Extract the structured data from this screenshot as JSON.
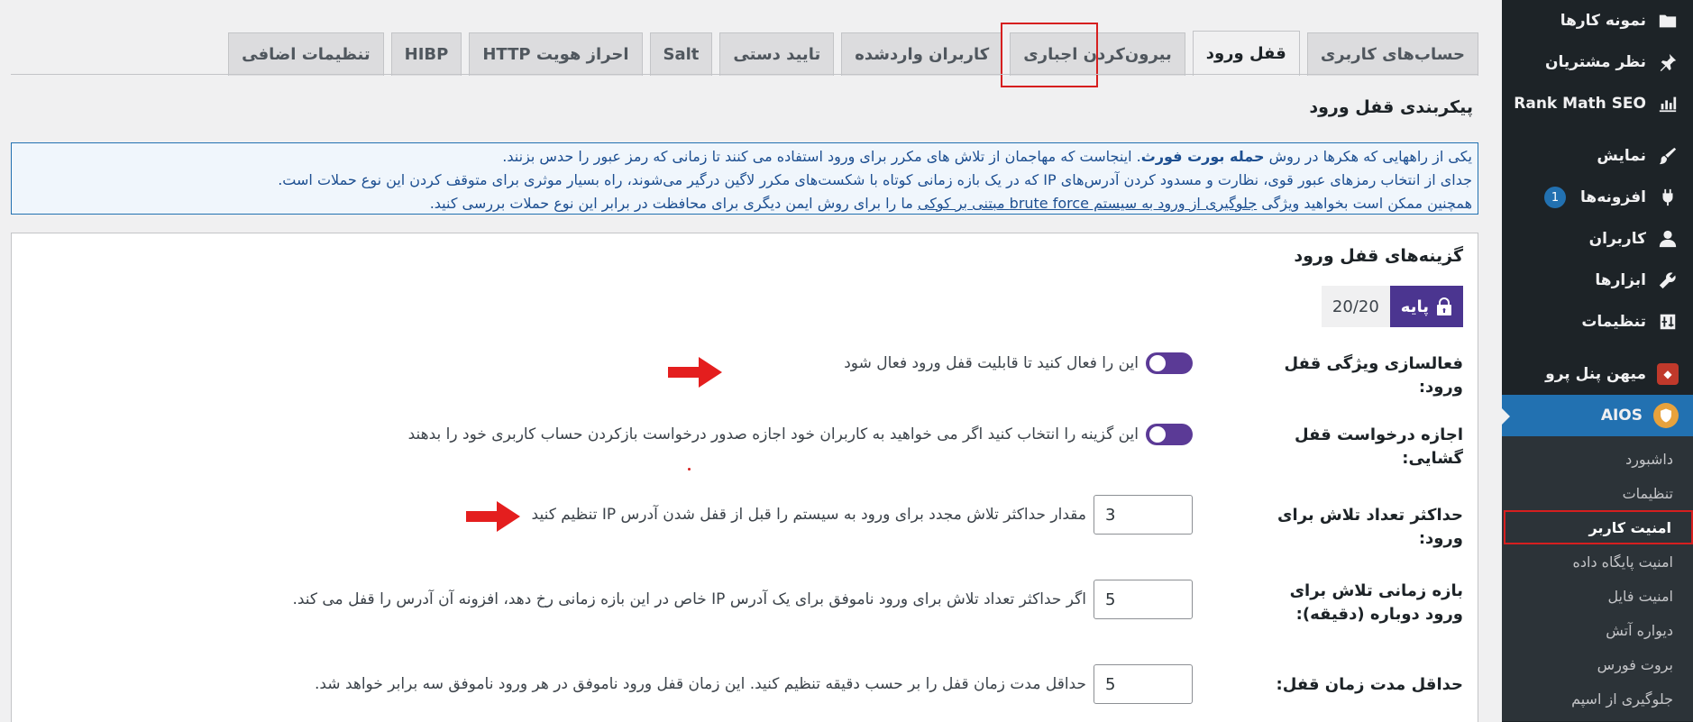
{
  "sidebar": {
    "items": [
      {
        "label": "نمونه کارها",
        "icon": "folder-icon"
      },
      {
        "label": "نظر مشتریان",
        "icon": "pin-icon"
      },
      {
        "label": "Rank Math SEO",
        "icon": "chart-icon"
      },
      {
        "label": "نمایش",
        "icon": "brush-icon"
      },
      {
        "label": "افزونه‌ها",
        "icon": "plugin-icon",
        "badge": "1"
      },
      {
        "label": "کاربران",
        "icon": "user-icon"
      },
      {
        "label": "ابزارها",
        "icon": "wrench-icon"
      },
      {
        "label": "تنظیمات",
        "icon": "settings-icon"
      },
      {
        "label": "میهن پنل پرو",
        "icon": "mihan-panel-icon"
      },
      {
        "label": "AIOS",
        "icon": "shield-icon"
      }
    ],
    "submenu": [
      "داشبورد",
      "تنظیمات",
      "امنیت کاربر",
      "امنیت پایگاه داده",
      "امنیت فایل",
      "دیواره آتش",
      "بروت فورس",
      "جلوگیری از اسپم"
    ]
  },
  "tabs": [
    "حساب‌های کاربری",
    "قفل ورود",
    "بیرون‌کردن اجباری",
    "کاربران واردشده",
    "تایید دستی",
    "Salt",
    "احراز هویت HTTP",
    "HIBP",
    "تنظیمات اضافی"
  ],
  "section_title": "پیکربندی قفل ورود",
  "info": {
    "line1_a": "یکی از راههایی که هکرها در روش ",
    "line1_bold": "حمله بورت فورث",
    "line1_b": ". اینجاست که مهاجمان از تلاش های مکرر برای ورود استفاده می کنند تا زمانی که رمز عبور را حدس بزنند.",
    "line2": "جدای از انتخاب رمزهای عبور قوی، نظارت و مسدود کردن آدرس‌های IP که در یک بازه زمانی کوتاه با شکست‌های مکرر لاگین درگیر می‌شوند، راه بسیار موثری برای متوقف کردن این نوع حملات است.",
    "line3_a": "همچنین ممکن است بخواهید ویژگی ",
    "line3_link": "جلوگیری از ورود به سیستم brute force مبتنی بر کوکی",
    "line3_b": " ما را برای روش ایمن دیگری برای محافظت در برابر این نوع حملات بررسی کنید."
  },
  "panel": {
    "title": "گزینه‌های قفل ورود",
    "level_label": "پایه",
    "level_score": "20/20",
    "rows": [
      {
        "label": "فعالسازی ویژگی قفل ورود:",
        "desc": "این را فعال کنید تا قابلیت قفل ورود فعال شود"
      },
      {
        "label": "اجازه درخواست قفل گشایی:",
        "desc": "این گزینه را انتخاب کنید اگر می خواهید به کاربران خود اجازه صدور درخواست بازکردن حساب کاربری خود را بدهند"
      },
      {
        "label": "حداکثر تعداد تلاش برای ورود:",
        "value": "3",
        "desc": "مقدار حداکثر تلاش مجدد برای ورود به سیستم را قبل از قفل شدن آدرس IP تنظیم کنید"
      },
      {
        "label": "بازه زمانی تلاش برای ورود دوباره (دقیقه):",
        "value": "5",
        "desc": "اگر حداکثر تعداد تلاش برای ورود ناموفق برای یک آدرس IP خاص در این بازه زمانی رخ دهد، افزونه آن آدرس را قفل می کند."
      },
      {
        "label": "حداقل مدت زمان قفل:",
        "value": "5",
        "desc": "حداقل مدت زمان قفل را بر حسب دقیقه تنظیم کنید. این زمان قفل ورود ناموفق در هر ورود ناموفق سه برابر خواهد شد."
      }
    ]
  },
  "colors": {
    "accent": "#2271b1",
    "toggle": "#5b3a96",
    "highlight": "#d61f1f",
    "sidebar": "#1d2327"
  }
}
